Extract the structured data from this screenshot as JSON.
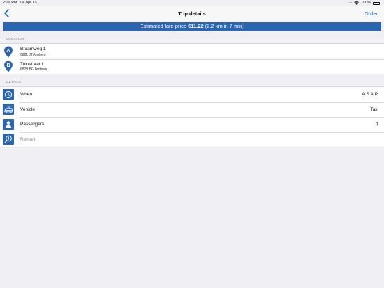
{
  "status_bar": {
    "time": "2:29 PM",
    "date": "Tue Apr 16",
    "battery_text": "100%"
  },
  "nav": {
    "title": "Trip details",
    "order_label": "Order"
  },
  "fare": {
    "prefix": "Estimated fare price",
    "price": "€11.22",
    "detail": "(2.2 km in 7 min)"
  },
  "location": {
    "header": "LOCATION",
    "items": [
      {
        "marker": "A",
        "name": "Braamweg 1",
        "sub": "6821 JT Arnhem"
      },
      {
        "marker": "B",
        "name": "Tuinstraat 1",
        "sub": "6828 BG Arnhem"
      }
    ]
  },
  "details": {
    "header": "DETAILS",
    "items": [
      {
        "icon": "clock-icon",
        "label": "When",
        "value": "A.S.A.P."
      },
      {
        "icon": "car-icon",
        "label": "Vehicle",
        "value": "Taxi"
      },
      {
        "icon": "person-icon",
        "label": "Passengers",
        "value": "1"
      },
      {
        "icon": "remark-icon",
        "label": "Remark",
        "value": ""
      }
    ]
  },
  "colors": {
    "accent": "#2a65b4",
    "link": "#1a6dcf",
    "background": "#efeff4"
  }
}
